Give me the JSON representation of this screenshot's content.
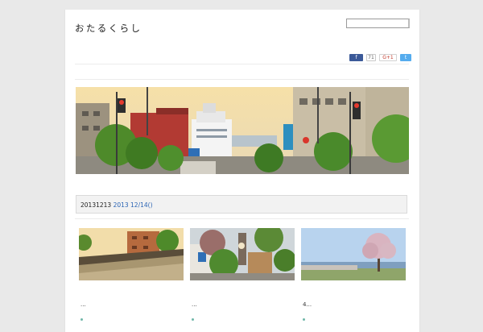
{
  "site": {
    "title": "おたるくらし"
  },
  "search": {
    "placeholder": ""
  },
  "social": {
    "facebook_label": "f",
    "facebook_count": "71",
    "googleplus_label": "G+1",
    "twitter_label": "t"
  },
  "archive": {
    "heading_text": "20131213 ",
    "heading_link": "2013 12/14()"
  },
  "posts": [
    {
      "caption": "..."
    },
    {
      "caption": "..."
    },
    {
      "caption": "4..."
    }
  ],
  "colors": {
    "accent_link": "#2a64b4",
    "facebook": "#3b5998",
    "twitter": "#55acee"
  }
}
